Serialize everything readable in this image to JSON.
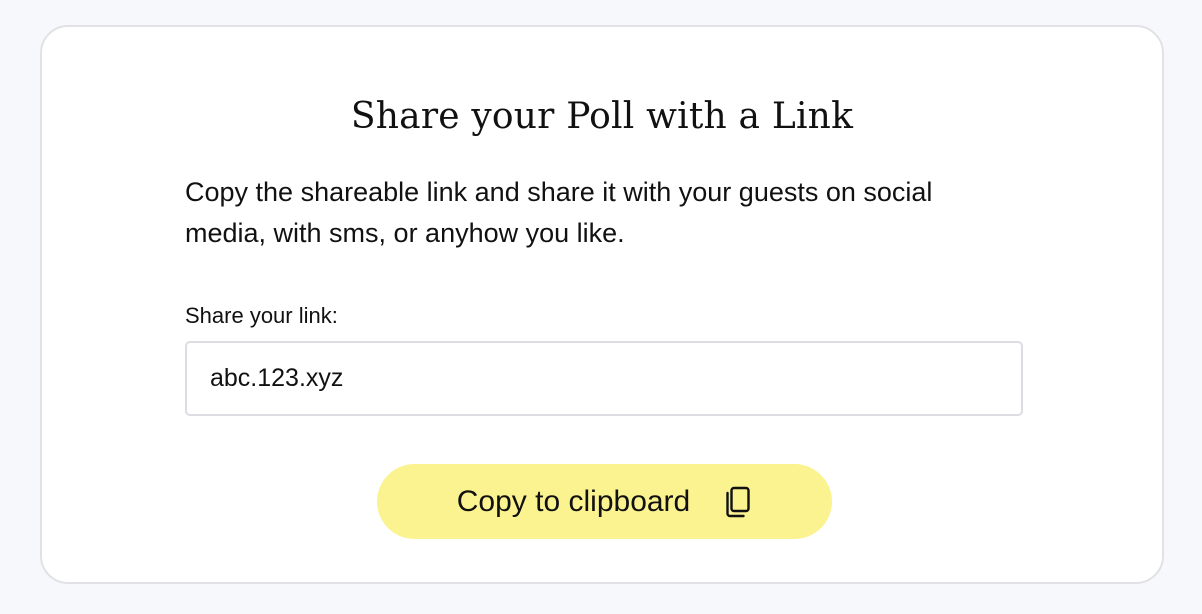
{
  "card": {
    "title": "Share your Poll with a Link",
    "description": "Copy the shareable link and share it with your guests on social media, with sms, or anyhow you like.",
    "link_label": "Share your link:",
    "link_value": "abc.123.xyz",
    "copy_button_label": "Copy to clipboard",
    "copy_button_icon": "copy-icon"
  },
  "colors": {
    "page_background": "#f7f8fc",
    "card_background": "#ffffff",
    "button_background": "#fbf290"
  }
}
